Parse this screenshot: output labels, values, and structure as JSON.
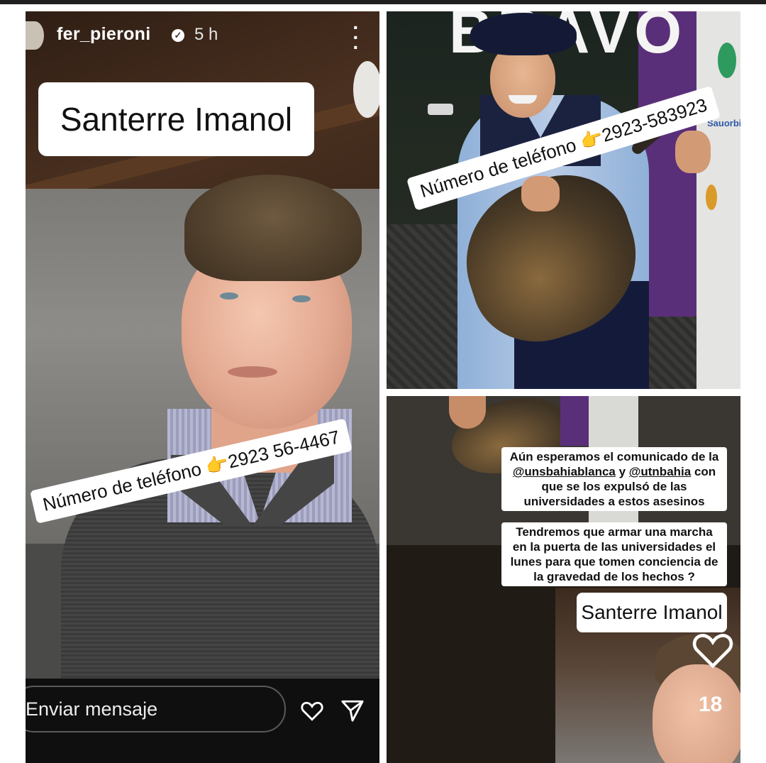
{
  "left_story": {
    "username": "fer_pieroni",
    "verified_mark": "✓",
    "time": "5 h",
    "more_icon": "more-vertical-icon",
    "name_label": "Santerre Imanol",
    "phone_label": "Número de teléfono 👉2923 56-4467",
    "message_placeholder": "Enviar mensaje",
    "heart_icon": "heart-outline-icon",
    "send_icon": "send-icon"
  },
  "top_right": {
    "sign_text": "BRAVO",
    "wall_label": "Sauorbid",
    "phone_label": "Número de teléfono 👉2923-583923"
  },
  "bottom_right": {
    "text_block_1": {
      "line1": "Aún esperamos el comunicado de la",
      "mention1": "@unsbahiablanca",
      "joiner": " y ",
      "mention2": "@utnbahia",
      "after_mentions": " con",
      "line3": "que se los expulsó de las",
      "line4": "universidades a estos asesinos"
    },
    "text_block_2": "Tendremos que armar una marcha en la puerta de las universidades el lunes para que tomen conciencia de la gravedad de los hechos ?",
    "name_label": "Santerre Imanol",
    "like_icon": "heart-outline-icon",
    "like_count": "18"
  },
  "colors": {
    "message_bar": "#0f0f0f",
    "purple_wall": "#5a2f7a",
    "label_bg": "#ffffff"
  }
}
